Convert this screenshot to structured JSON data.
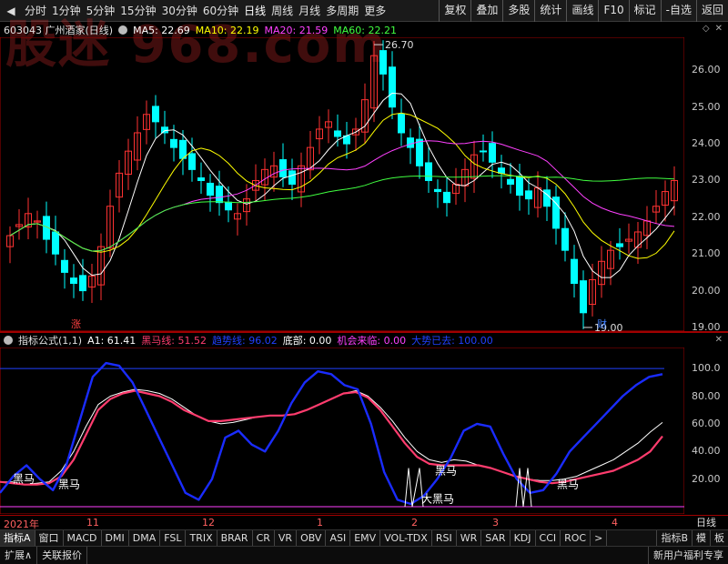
{
  "toolbar": {
    "periods": [
      "分时",
      "1分钟",
      "5分钟",
      "15分钟",
      "30分钟",
      "60分钟",
      "日线",
      "周线",
      "月线",
      "多周期",
      "更多"
    ],
    "active_period": "日线",
    "buttons": [
      "复权",
      "叠加",
      "多股",
      "统计",
      "画线",
      "F10",
      "标记",
      "-自选",
      "返回"
    ]
  },
  "watermark": "股迷 968.com",
  "main_info": {
    "stock": "603043 广州酒家(日线)",
    "ma5_label": "MA5: 22.69",
    "ma10_label": "MA10: 22.19",
    "ma20_label": "MA20: 21.59",
    "ma60_label": "MA60: 22.21",
    "colors": {
      "ma5": "#ffffff",
      "ma10": "#ffff00",
      "ma20": "#ff40ff",
      "ma60": "#40ff40"
    }
  },
  "price_axis": [
    "26.00",
    "25.00",
    "24.00",
    "23.00",
    "22.00",
    "21.00",
    "20.00",
    "19.00"
  ],
  "price_annotations": {
    "high": "26.70",
    "low": "19.00",
    "zhang": "涨",
    "cai": "财"
  },
  "indicator_info": {
    "name": "指标公式(1,1)",
    "a1": "A1: 61.41",
    "heima_line": "黑马线: 51.52",
    "trend_line": "趋势线: 96.02",
    "bottom": "底部: 0.00",
    "opportunity": "机会来临: 0.00",
    "trend_gone": "大势已去: 100.00"
  },
  "indicator_axis": [
    "100.0",
    "80.00",
    "60.00",
    "40.00",
    "20.00"
  ],
  "indicator_annotations": {
    "heima": "黑马",
    "da_heima": "大黑马"
  },
  "x_axis": {
    "labels": [
      "2021年",
      "11",
      "12",
      "1",
      "2",
      "3",
      "4"
    ],
    "right": "日线"
  },
  "tabs": [
    "指标A",
    "窗口",
    "MACD",
    "DMI",
    "DMA",
    "FSL",
    "TRIX",
    "BRAR",
    "CR",
    "VR",
    "OBV",
    "ASI",
    "EMV",
    "VOL-TDX",
    "RSI",
    "WR",
    "SAR",
    "KDJ",
    "CCI",
    "ROC",
    ">"
  ],
  "right_tabs": [
    "指标B",
    "模",
    "板"
  ],
  "statusbar": {
    "left": [
      "扩展∧",
      "关联报价"
    ],
    "right": "新用户福利专享"
  },
  "chart_data": {
    "type": "candlestick_with_indicator",
    "price_ylim": [
      18.9,
      26.9
    ],
    "price_high": 26.7,
    "price_low": 19.0,
    "ma_last": {
      "MA5": 22.69,
      "MA10": 22.19,
      "MA20": 21.59,
      "MA60": 22.21
    },
    "close_points": [
      21.5,
      21.8,
      22.1,
      21.9,
      21.4,
      21.0,
      20.5,
      20.2,
      20.0,
      20.4,
      21.2,
      22.3,
      23.2,
      23.8,
      24.3,
      24.8,
      24.6,
      24.3,
      23.9,
      23.6,
      23.3,
      23.0,
      22.6,
      22.4,
      22.2,
      22.1,
      22.5,
      23.0,
      23.3,
      23.4,
      23.1,
      22.9,
      23.4,
      23.9,
      24.4,
      24.6,
      24.2,
      24.0,
      24.4,
      25.2,
      26.4,
      25.9,
      25.0,
      24.3,
      23.9,
      23.4,
      23.0,
      22.7,
      22.4,
      22.9,
      23.3,
      23.7,
      23.8,
      23.5,
      23.2,
      22.9,
      22.6,
      22.5,
      22.8,
      22.3,
      21.7,
      21.1,
      20.2,
      19.4,
      20.3,
      20.8,
      21.1,
      21.2,
      21.4,
      21.6,
      21.9,
      22.3,
      22.7,
      23.0
    ],
    "indicator_ylim": [
      0,
      110
    ],
    "series": [
      {
        "name": "A1",
        "values": [
          18,
          18,
          16,
          17,
          18,
          26,
          40,
          58,
          74,
          80,
          83,
          85,
          84,
          82,
          78,
          72,
          66,
          62,
          60,
          61,
          63,
          65,
          66,
          66,
          67,
          70,
          74,
          78,
          82,
          84,
          80,
          72,
          62,
          50,
          40,
          34,
          32,
          34,
          33,
          30,
          28,
          25,
          22,
          20,
          19,
          19,
          20,
          22,
          26,
          30,
          34,
          40,
          46,
          54,
          61
        ]
      },
      {
        "name": "黑马线",
        "values": [
          18,
          17,
          16,
          16,
          17,
          22,
          34,
          52,
          70,
          78,
          82,
          84,
          82,
          80,
          76,
          70,
          66,
          62,
          62,
          63,
          64,
          65,
          66,
          66,
          67,
          70,
          74,
          78,
          82,
          83,
          79,
          70,
          58,
          46,
          36,
          31,
          30,
          30,
          30,
          30,
          28,
          25,
          22,
          20,
          18,
          17,
          18,
          20,
          22,
          24,
          26,
          30,
          34,
          40,
          51
        ]
      },
      {
        "name": "趋势线",
        "values": [
          10,
          22,
          30,
          20,
          12,
          30,
          62,
          94,
          104,
          102,
          90,
          70,
          50,
          30,
          10,
          5,
          20,
          50,
          55,
          45,
          40,
          55,
          75,
          90,
          98,
          96,
          88,
          85,
          60,
          25,
          5,
          2,
          8,
          20,
          35,
          55,
          60,
          58,
          38,
          20,
          10,
          12,
          24,
          40,
          50,
          60,
          70,
          80,
          88,
          94,
          96
        ]
      }
    ],
    "reference_lines": [
      100,
      0
    ]
  }
}
